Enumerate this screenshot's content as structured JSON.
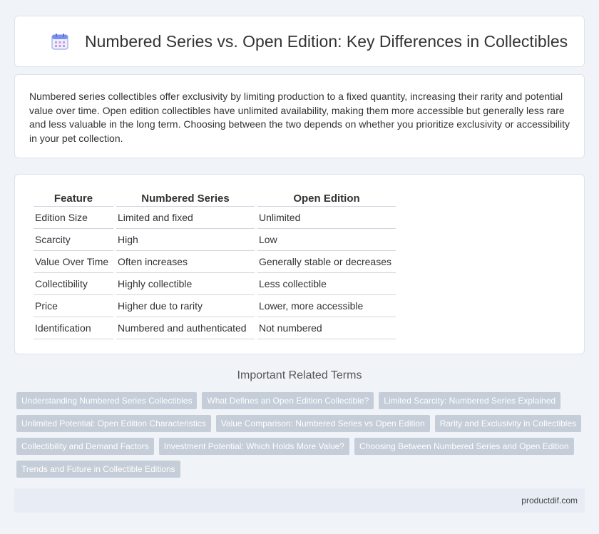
{
  "header": {
    "title": "Numbered Series vs. Open Edition: Key Differences in Collectibles",
    "icon": "calendar-icon"
  },
  "intro": {
    "text": "Numbered series collectibles offer exclusivity by limiting production to a fixed quantity, increasing their rarity and potential value over time. Open edition collectibles have unlimited availability, making them more accessible but generally less rare and less valuable in the long term. Choosing between the two depends on whether you prioritize exclusivity or accessibility in your pet collection."
  },
  "comparison": {
    "headers": [
      "Feature",
      "Numbered Series",
      "Open Edition"
    ],
    "rows": [
      [
        "Edition Size",
        "Limited and fixed",
        "Unlimited"
      ],
      [
        "Scarcity",
        "High",
        "Low"
      ],
      [
        "Value Over Time",
        "Often increases",
        "Generally stable or decreases"
      ],
      [
        "Collectibility",
        "Highly collectible",
        "Less collectible"
      ],
      [
        "Price",
        "Higher due to rarity",
        "Lower, more accessible"
      ],
      [
        "Identification",
        "Numbered and authenticated",
        "Not numbered"
      ]
    ]
  },
  "related": {
    "title": "Important Related Terms",
    "tags": [
      "Understanding Numbered Series Collectibles",
      "What Defines an Open Edition Collectible?",
      "Limited Scarcity: Numbered Series Explained",
      "Unlimited Potential: Open Edition Characteristics",
      "Value Comparison: Numbered Series vs Open Edition",
      "Rarity and Exclusivity in Collectibles",
      "Collectibility and Demand Factors",
      "Investment Potential: Which Holds More Value?",
      "Choosing Between Numbered Series and Open Edition",
      "Trends and Future in Collectible Editions"
    ]
  },
  "footer": {
    "site": "productdif.com"
  },
  "colors": {
    "page_bg": "#f0f3f8",
    "tag_bg": "#c5cdd8",
    "footer_bg": "#e8edf5",
    "icon_accent": "#7b8ff0"
  }
}
